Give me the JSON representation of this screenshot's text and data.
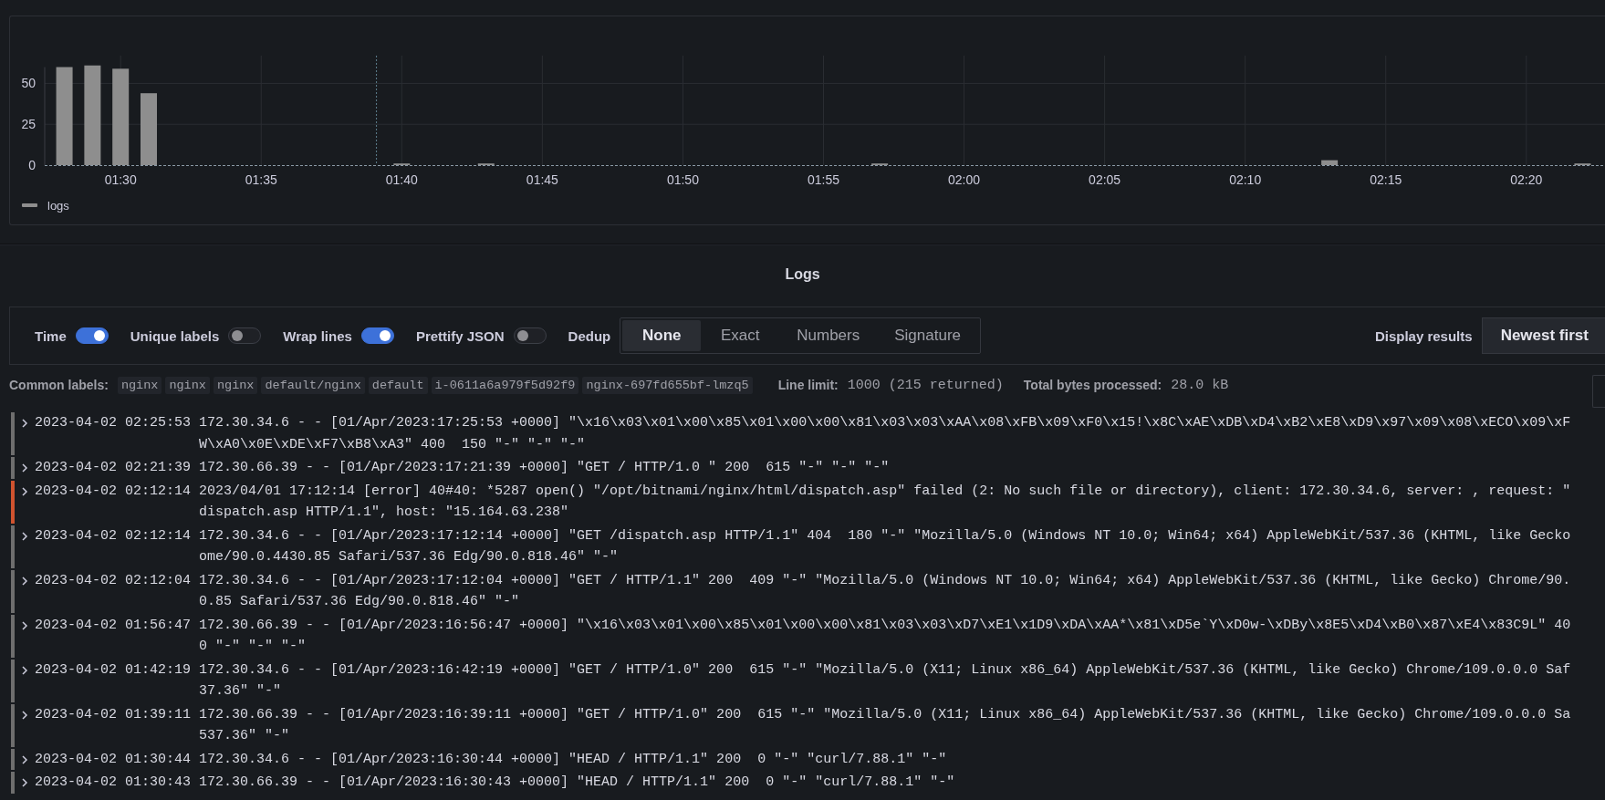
{
  "chart_panel": {
    "chart_data": {
      "type": "bar",
      "ylim": [
        0,
        67
      ],
      "xlim": [
        87.3,
        142.7
      ],
      "yticks": [
        0,
        25,
        50
      ],
      "xticks": [
        {
          "value": 90,
          "label": "01:30"
        },
        {
          "value": 95,
          "label": "01:35"
        },
        {
          "value": 100,
          "label": "01:40"
        },
        {
          "value": 105,
          "label": "01:45"
        },
        {
          "value": 110,
          "label": "01:50"
        },
        {
          "value": 115,
          "label": "01:55"
        },
        {
          "value": 120,
          "label": "02:00"
        },
        {
          "value": 125,
          "label": "02:05"
        },
        {
          "value": 130,
          "label": "02:10"
        },
        {
          "value": 135,
          "label": "02:15"
        },
        {
          "value": 140,
          "label": "02:20"
        }
      ],
      "x": [
        88,
        89,
        90,
        91,
        100,
        103,
        117,
        133,
        142
      ],
      "series": [
        {
          "name": "logs",
          "color": "#8e8e8e",
          "values": [
            60,
            61,
            59,
            44,
            1,
            1,
            1,
            3,
            1
          ]
        }
      ],
      "grid": true,
      "ref_lines": [
        {
          "axis": "x",
          "value": 99.1
        }
      ]
    }
  },
  "logs_panel": {
    "title": "Logs",
    "options": {
      "toggles": [
        {
          "label": "Time",
          "on": true
        },
        {
          "label": "Unique labels",
          "on": false
        },
        {
          "label": "Wrap lines",
          "on": true
        },
        {
          "label": "Prettify JSON",
          "on": false
        }
      ],
      "dedup": {
        "label": "Dedup",
        "options": [
          {
            "label": "None",
            "selected": true
          },
          {
            "label": "Exact",
            "selected": false
          },
          {
            "label": "Numbers",
            "selected": false
          },
          {
            "label": "Signature",
            "selected": false
          }
        ]
      },
      "display_results": {
        "label": "Display results",
        "button": "Newest first"
      }
    },
    "meta": {
      "common_labels_label": "Common labels:",
      "common_labels": [
        "nginx",
        "nginx",
        "nginx",
        "default/nginx",
        "default",
        "i-0611a6a979f5d92f9",
        "nginx-697fd655bf-lmzq5"
      ],
      "line_limit_label": "Line limit:",
      "line_limit": "1000 (215 returned)",
      "bytes_label": "Total bytes processed:",
      "bytes": "28.0 kB"
    },
    "entries": [
      {
        "color": "#6e6e6e",
        "time": "2023-04-02 02:25:53",
        "lines": [
          "172.30.34.6 - - [01/Apr/2023:17:25:53 +0000] \"\\x16\\x03\\x01\\x00\\x85\\x01\\x00\\x00\\x81\\x03\\x03\\xAA\\x08\\xFB\\x09\\xF0\\x15!\\x8C\\xAE\\xDB\\xD4\\xB2\\xE8\\xD9\\x97\\x09\\x08\\xECO\\x09\\xF",
          "W\\xA0\\x0E\\xDE\\xF7\\xB8\\xA3\" 400  150 \"-\" \"-\" \"-\""
        ]
      },
      {
        "color": "#6e6e6e",
        "time": "2023-04-02 02:21:39",
        "lines": [
          "172.30.66.39 - - [01/Apr/2023:17:21:39 +0000] \"GET / HTTP/1.0 \" 200  615 \"-\" \"-\" \"-\""
        ]
      },
      {
        "color": "#d0532f",
        "time": "2023-04-02 02:12:14",
        "lines": [
          "2023/04/01 17:12:14 [error] 40#40: *5287 open() \"/opt/bitnami/nginx/html/dispatch.asp\" failed (2: No such file or directory), client: 172.30.34.6, server: , request: \"",
          "dispatch.asp HTTP/1.1\", host: \"15.164.63.238\""
        ]
      },
      {
        "color": "#6e6e6e",
        "time": "2023-04-02 02:12:14",
        "lines": [
          "172.30.34.6 - - [01/Apr/2023:17:12:14 +0000] \"GET /dispatch.asp HTTP/1.1\" 404  180 \"-\" \"Mozilla/5.0 (Windows NT 10.0; Win64; x64) AppleWebKit/537.36 (KHTML, like Gecko",
          "ome/90.0.4430.85 Safari/537.36 Edg/90.0.818.46\" \"-\""
        ]
      },
      {
        "color": "#6e6e6e",
        "time": "2023-04-02 02:12:04",
        "lines": [
          "172.30.34.6 - - [01/Apr/2023:17:12:04 +0000] \"GET / HTTP/1.1\" 200  409 \"-\" \"Mozilla/5.0 (Windows NT 10.0; Win64; x64) AppleWebKit/537.36 (KHTML, like Gecko) Chrome/90.",
          "0.85 Safari/537.36 Edg/90.0.818.46\" \"-\""
        ]
      },
      {
        "color": "#6e6e6e",
        "time": "2023-04-02 01:56:47",
        "lines": [
          "172.30.66.39 - - [01/Apr/2023:16:56:47 +0000] \"\\x16\\x03\\x01\\x00\\x85\\x01\\x00\\x00\\x81\\x03\\x03\\xD7\\xE1\\x1D9\\xDA\\xAA*\\x81\\xD5e`Y\\xD0w-\\xDBy\\x8E5\\xD4\\xB0\\x87\\xE4\\x83C9L\" 40",
          "0 \"-\" \"-\" \"-\""
        ]
      },
      {
        "color": "#6e6e6e",
        "time": "2023-04-02 01:42:19",
        "lines": [
          "172.30.34.6 - - [01/Apr/2023:16:42:19 +0000] \"GET / HTTP/1.0\" 200  615 \"-\" \"Mozilla/5.0 (X11; Linux x86_64) AppleWebKit/537.36 (KHTML, like Gecko) Chrome/109.0.0.0 Saf",
          "37.36\" \"-\""
        ]
      },
      {
        "color": "#6e6e6e",
        "time": "2023-04-02 01:39:11",
        "lines": [
          "172.30.66.39 - - [01/Apr/2023:16:39:11 +0000] \"GET / HTTP/1.0\" 200  615 \"-\" \"Mozilla/5.0 (X11; Linux x86_64) AppleWebKit/537.36 (KHTML, like Gecko) Chrome/109.0.0.0 Sa",
          "537.36\" \"-\""
        ]
      },
      {
        "color": "#6e6e6e",
        "time": "2023-04-02 01:30:44",
        "lines": [
          "172.30.34.6 - - [01/Apr/2023:16:30:44 +0000] \"HEAD / HTTP/1.1\" 200  0 \"-\" \"curl/7.88.1\" \"-\""
        ]
      },
      {
        "color": "#6e6e6e",
        "time": "2023-04-02 01:30:43",
        "lines": [
          "172.30.66.39 - - [01/Apr/2023:16:30:43 +0000] \"HEAD / HTTP/1.1\" 200  0 \"-\" \"curl/7.88.1\" \"-\""
        ]
      }
    ]
  }
}
